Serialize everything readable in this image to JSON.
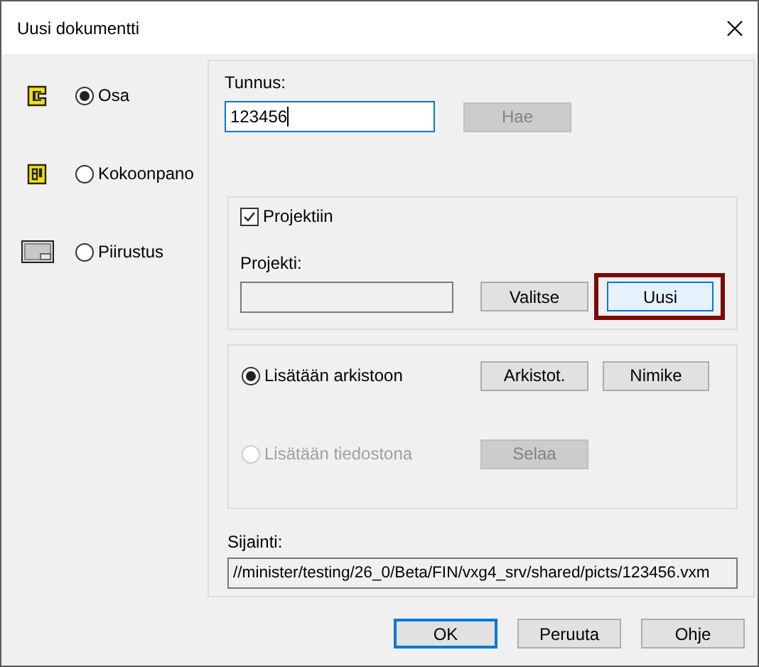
{
  "window": {
    "title": "Uusi dokumentti"
  },
  "document_types": [
    {
      "kind": "part",
      "label": "Osa",
      "selected": true
    },
    {
      "kind": "assembly",
      "label": "Kokoonpano",
      "selected": false
    },
    {
      "kind": "drawing",
      "label": "Piirustus",
      "selected": false
    }
  ],
  "identifier": {
    "label": "Tunnus:",
    "value": "123456",
    "fetch_button": {
      "label": "Hae",
      "disabled": true
    }
  },
  "project": {
    "checkbox": {
      "label": "Projektiin",
      "checked": true
    },
    "field_label": "Projekti:",
    "field_disabled": true,
    "buttons": [
      {
        "label": "Valitse",
        "hovered": false,
        "highlighted": false
      },
      {
        "label": "Uusi",
        "hovered": true,
        "highlighted": true
      }
    ]
  },
  "storage": {
    "options": [
      {
        "label": "Lisätään arkistoon",
        "selected": true,
        "disabled": false,
        "buttons": [
          {
            "label": "Arkistot.",
            "disabled": false
          },
          {
            "label": "Nimike",
            "disabled": false
          }
        ]
      },
      {
        "label": "Lisätään tiedostona",
        "selected": false,
        "disabled": true,
        "buttons": [
          {
            "label": "Selaa",
            "disabled": true
          }
        ]
      }
    ]
  },
  "location": {
    "label": "Sijainti:",
    "value": "//minister/testing/26_0/Beta/FIN/vxg4_srv/shared/picts/123456.vxm"
  },
  "buttons": [
    {
      "label": "OK",
      "focused": true
    },
    {
      "label": "Peruuta",
      "focused": false
    },
    {
      "label": "Ohje",
      "focused": false
    }
  ]
}
